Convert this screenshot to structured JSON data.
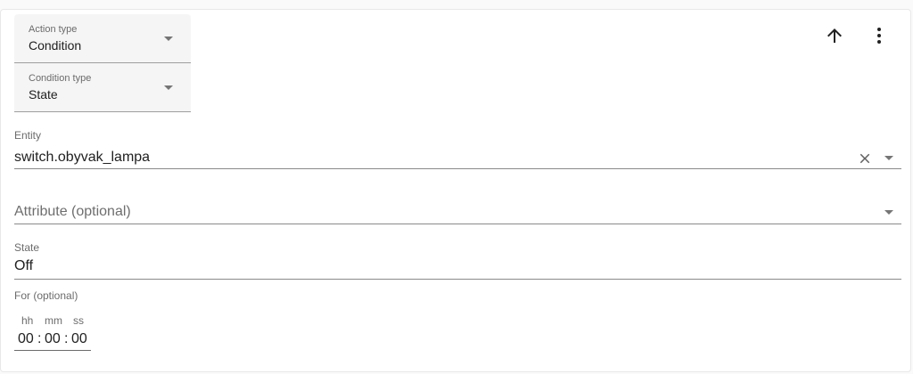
{
  "action_type": {
    "label": "Action type",
    "value": "Condition"
  },
  "condition_type": {
    "label": "Condition type",
    "value": "State"
  },
  "toolbar": {
    "move_up_icon": "arrow-up-icon",
    "menu_icon": "more-vertical-icon"
  },
  "entity": {
    "label": "Entity",
    "value": "switch.obyvak_lampa"
  },
  "attribute": {
    "placeholder": "Attribute (optional)"
  },
  "state": {
    "label": "State",
    "value": "Off"
  },
  "for": {
    "label": "For (optional)",
    "units": {
      "hours": "hh",
      "minutes": "mm",
      "seconds": "ss"
    },
    "hours": "00",
    "minutes": "00",
    "seconds": "00",
    "separator": ":"
  }
}
